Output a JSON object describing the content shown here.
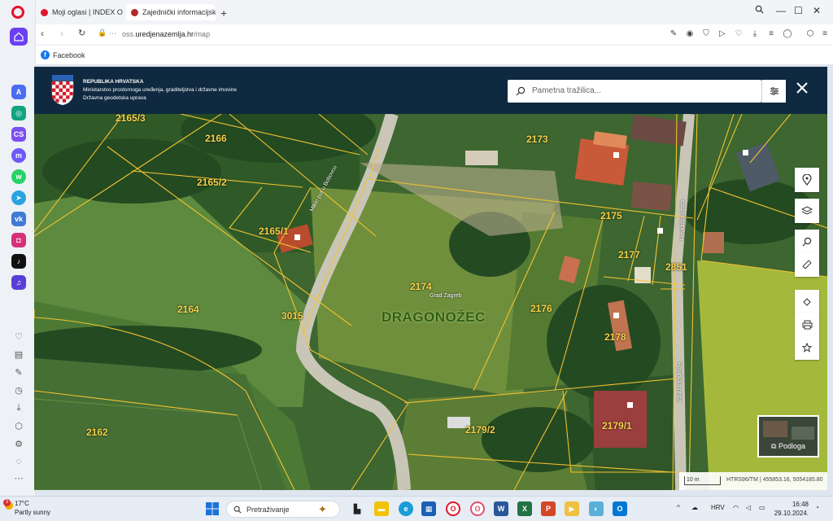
{
  "browser": {
    "tabs": [
      {
        "title": "Moji oglasi | INDEX OGLA",
        "active": false
      },
      {
        "title": "Zajednički informacijski s",
        "active": true
      }
    ],
    "url_prefix": "oss.",
    "url_domain": "uredjenazemlja.hr",
    "url_path": "/map",
    "bookmarks": [
      {
        "label": "Facebook"
      }
    ]
  },
  "header": {
    "line1": "REPUBLIKA HRVATSKA",
    "line2": "Ministarstvo prostornoga uređenja, graditeljstva i državne imovine",
    "line3": "Državna geodetska uprava",
    "search_placeholder": "Pametna tražilica..."
  },
  "map": {
    "settlement": "DRAGONOŽEC",
    "district": "Grad Zagreb",
    "roads": [
      "Mikin put u Bobovcu",
      "Havidićka cesta",
      "Havidićka cesta"
    ],
    "parcels": [
      "2165/3",
      "2166",
      "2165/2",
      "2165/1",
      "2164",
      "3015",
      "2174",
      "2173",
      "2175",
      "2177",
      "2851",
      "2176",
      "2178",
      "2162",
      "2179/2",
      "2179/1"
    ],
    "basemap_label": "Podloga",
    "scale_label": "10 m",
    "coords": "HTRS96/TM | 455853.16, 5054185.80"
  },
  "taskbar": {
    "weather_temp": "17°C",
    "weather_desc": "Partly sunny",
    "weather_badge": "3",
    "search_placeholder": "Pretraživanje",
    "language": "HRV",
    "time": "16:48",
    "date": "29.10.2024."
  }
}
